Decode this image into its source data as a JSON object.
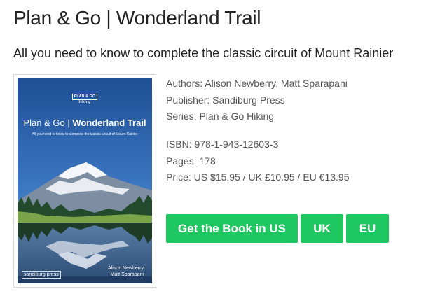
{
  "page": {
    "title": "Plan & Go | Wonderland Trail",
    "subtitle": "All you need to know to complete the classic circuit of Mount Rainier"
  },
  "book_cover": {
    "logo_line1": "PLAN & GO",
    "logo_line2": "Hiking",
    "title_part1": "Plan & Go",
    "title_part2": "Wonderland Trail",
    "tagline": "All you need to know to complete the classic circuit of Mount Rainier",
    "publisher": "sandiburg press",
    "author1": "Alison Newberry",
    "author2": "Matt Sparapani"
  },
  "details": {
    "authors": "Authors: Alison Newberry, Matt Sparapani",
    "publisher": "Publisher: Sandiburg Press",
    "series": "Series: Plan & Go Hiking",
    "isbn": "ISBN: 978-1-943-12603-3",
    "pages": "Pages: 178",
    "price": "Price: US $15.95 / UK £10.95 / EU €13.95"
  },
  "buttons": {
    "us": "Get the Book in US",
    "uk": "UK",
    "eu": "EU"
  },
  "colors": {
    "button": "#1ec75f",
    "text": "#222222",
    "meta_text": "#555555"
  }
}
